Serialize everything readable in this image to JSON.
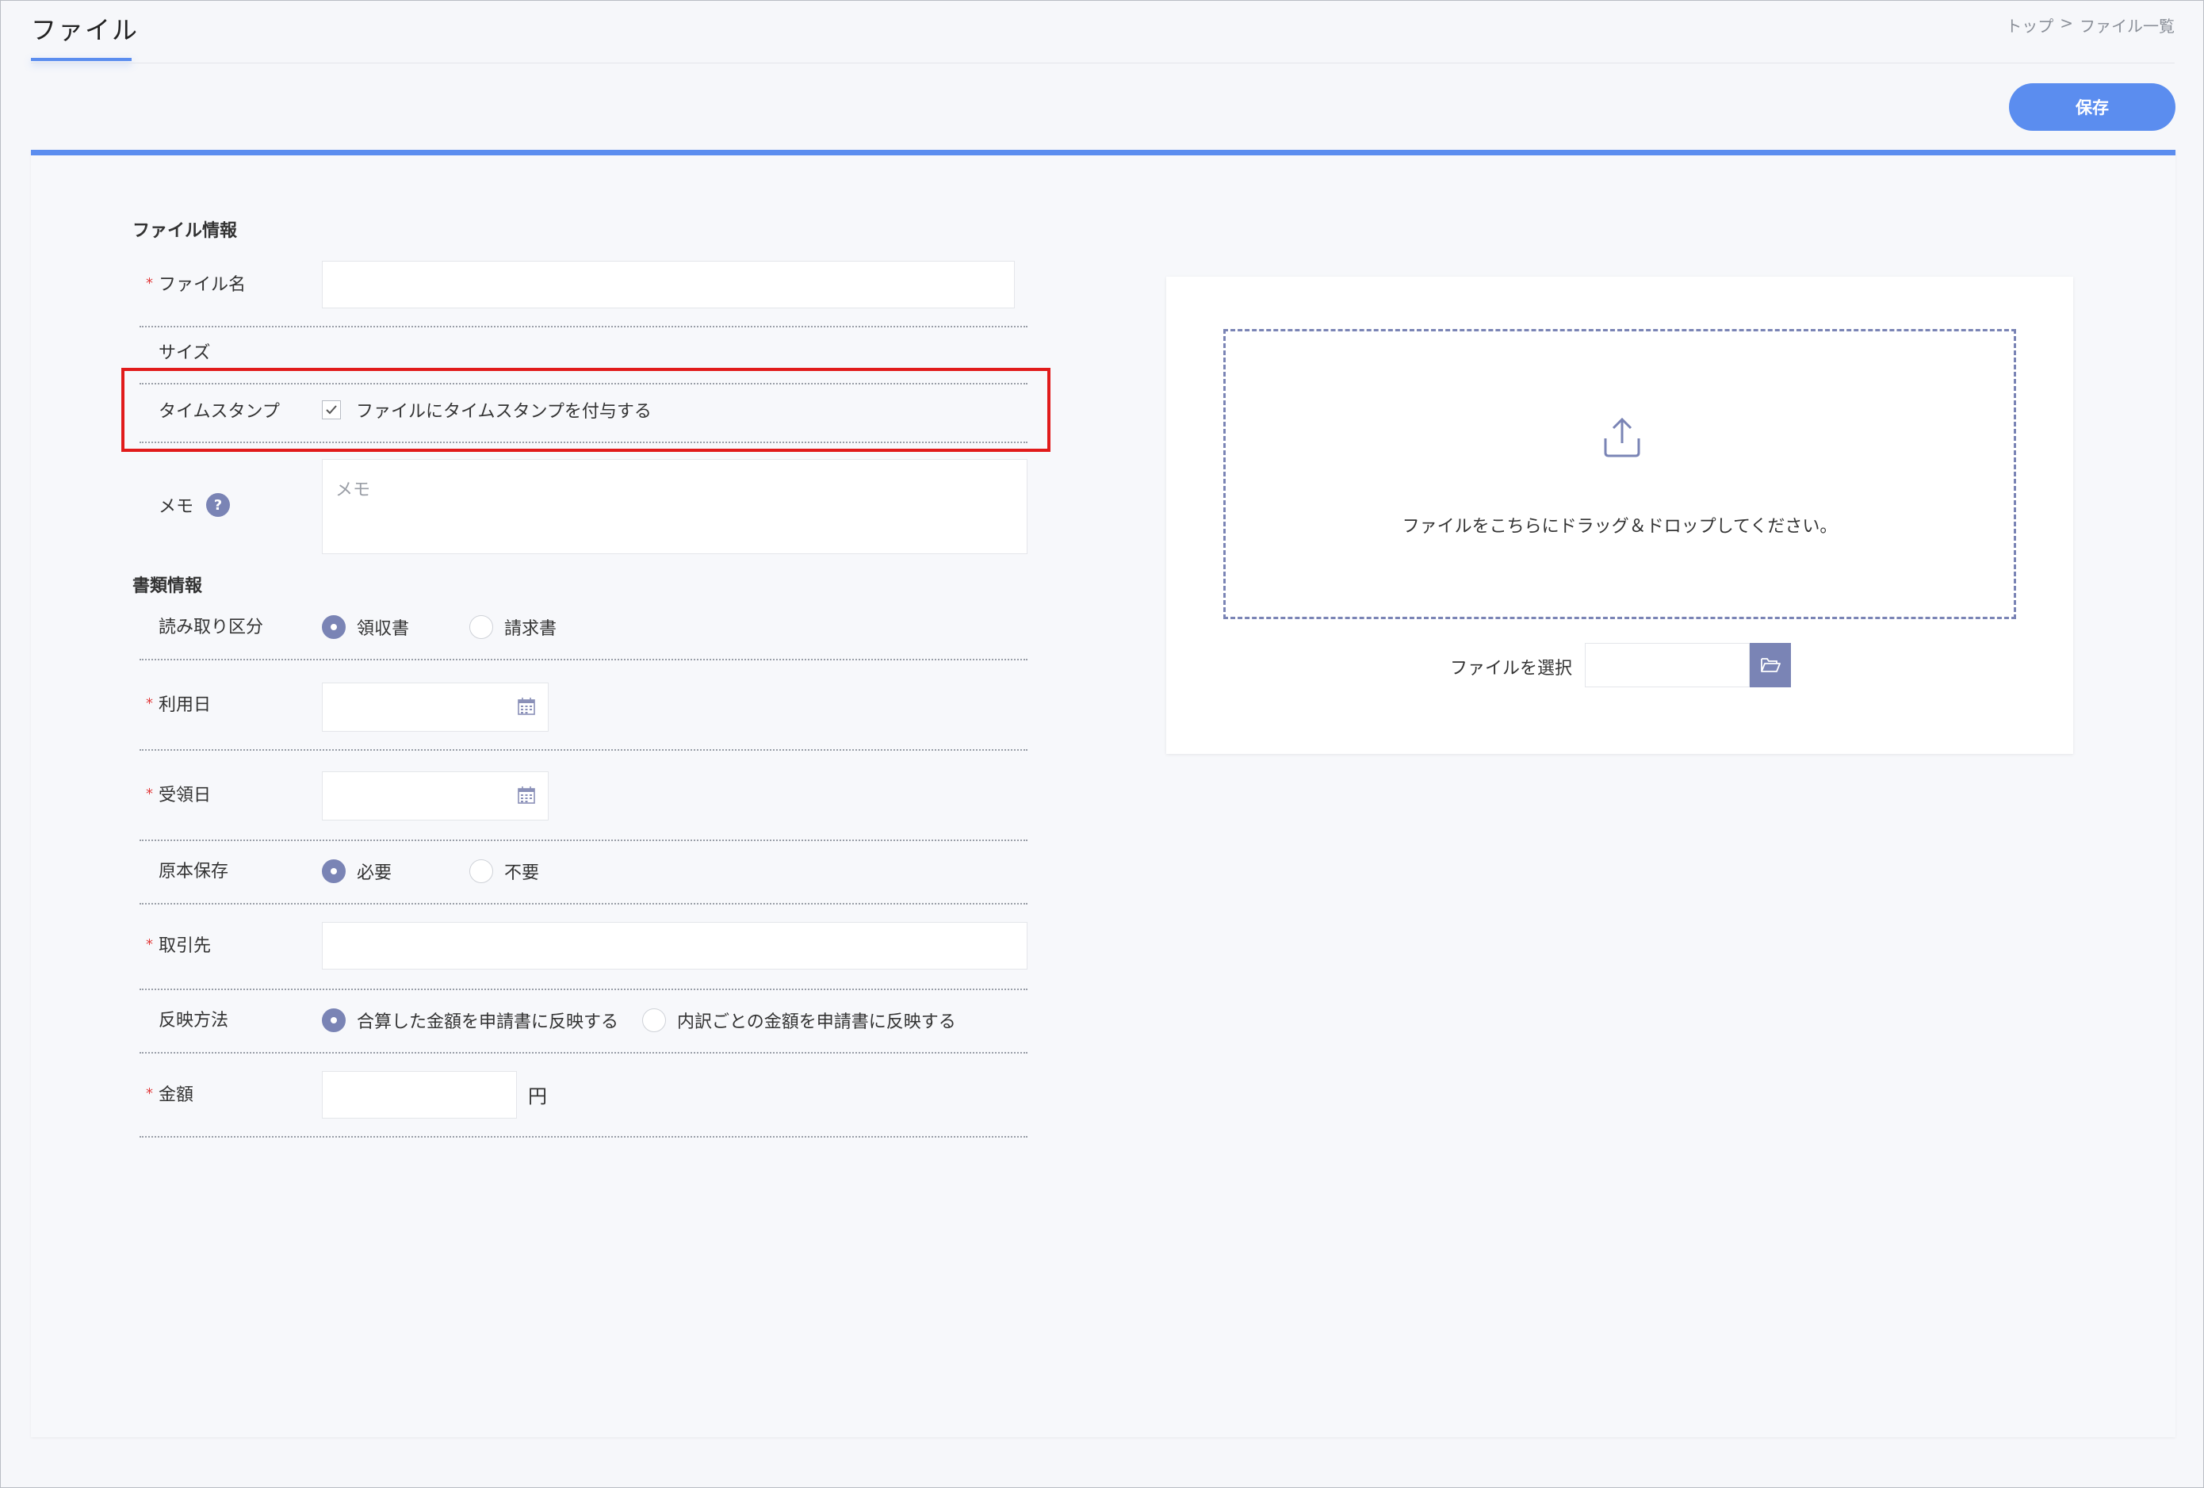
{
  "header": {
    "title": "ファイル",
    "breadcrumb": [
      "トップ",
      ">",
      "ファイル一覧"
    ],
    "save_label": "保存"
  },
  "file_info": {
    "heading": "ファイル情報",
    "file_name_label": "ファイル名",
    "file_name_value": "",
    "size_label": "サイズ",
    "size_value": "",
    "timestamp_label": "タイムスタンプ",
    "timestamp_checkbox_label": "ファイルにタイムスタンプを付与する",
    "timestamp_checked": true,
    "memo_label": "メモ",
    "memo_placeholder": "メモ",
    "help_icon": "?"
  },
  "document_info": {
    "heading": "書類情報",
    "read_type_label": "読み取り区分",
    "read_type_options": [
      "領収書",
      "請求書"
    ],
    "read_type_selected": "領収書",
    "use_date_label": "利用日",
    "use_date_value": "",
    "receipt_date_label": "受領日",
    "receipt_date_value": "",
    "original_storage_label": "原本保存",
    "original_storage_options": [
      "必要",
      "不要"
    ],
    "original_storage_selected": "必要",
    "partner_label": "取引先",
    "partner_value": "",
    "reflect_label": "反映方法",
    "reflect_options": [
      "合算した金額を申請書に反映する",
      "内訳ごとの金額を申請書に反映する"
    ],
    "reflect_selected": "合算した金額を申請書に反映する",
    "amount_label": "金額",
    "amount_value": "",
    "amount_unit": "円",
    "required_mark": "*"
  },
  "upload": {
    "drop_text": "ファイルをこちらにドラッグ＆ドロップしてください。",
    "select_label": "ファイルを選択",
    "select_value": ""
  },
  "colors": {
    "accent": "#5b8def",
    "radio_checked": "#7a84b5",
    "required": "#e23b3b",
    "highlight": "#e11b1b"
  }
}
